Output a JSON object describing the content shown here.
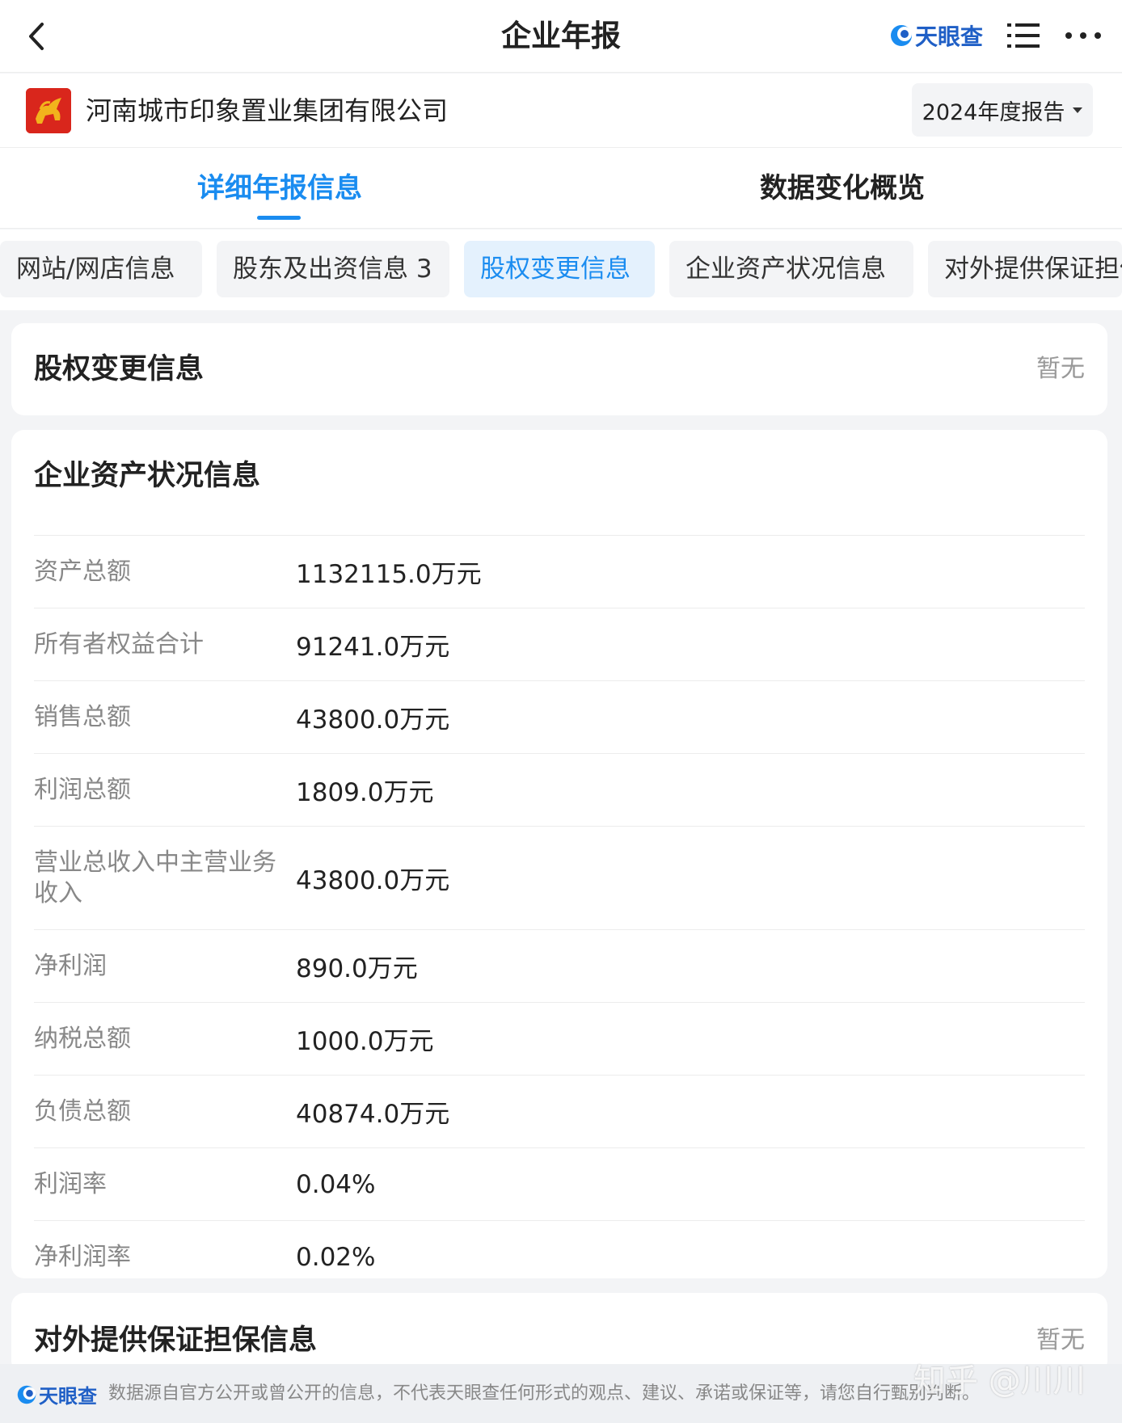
{
  "header": {
    "title": "企业年报",
    "brand_name": "天眼查"
  },
  "company": {
    "name": "河南城市印象置业集团有限公司",
    "year_select": "2024年度报告"
  },
  "main_tabs": [
    {
      "label": "详细年报信息",
      "active": true
    },
    {
      "label": "数据变化概览",
      "active": false
    }
  ],
  "sub_tabs": [
    {
      "label": "网站/网店信息"
    },
    {
      "label": "股东及出资信息 3"
    },
    {
      "label": "股权变更信息"
    },
    {
      "label": "企业资产状况信息"
    },
    {
      "label": "对外提供保证担保信息"
    }
  ],
  "equity_change": {
    "title": "股权变更信息",
    "status": "暂无"
  },
  "assets": {
    "title": "企业资产状况信息",
    "rows": [
      {
        "label": "资产总额",
        "value": "1132115.0万元"
      },
      {
        "label": "所有者权益合计",
        "value": "91241.0万元"
      },
      {
        "label": "销售总额",
        "value": "43800.0万元"
      },
      {
        "label": "利润总额",
        "value": "1809.0万元"
      },
      {
        "label": "营业总收入中主营业务收入",
        "value": "43800.0万元"
      },
      {
        "label": "净利润",
        "value": "890.0万元"
      },
      {
        "label": "纳税总额",
        "value": "1000.0万元"
      },
      {
        "label": "负债总额",
        "value": "40874.0万元"
      },
      {
        "label": "利润率",
        "value": "0.04%"
      },
      {
        "label": "净利润率",
        "value": "0.02%"
      }
    ]
  },
  "guarantee": {
    "title": "对外提供保证担保信息",
    "status": "暂无"
  },
  "footer": {
    "brand_name": "天眼查",
    "disclaimer": "数据源自官方公开或曾公开的信息，不代表天眼查任何形式的观点、建议、承诺或保证等，请您自行甄别判断。"
  },
  "watermark": "知乎 @川川",
  "colors": {
    "accent": "#1a8cf0",
    "brand": "#1f5fc6",
    "logo_red": "#d9261c"
  }
}
